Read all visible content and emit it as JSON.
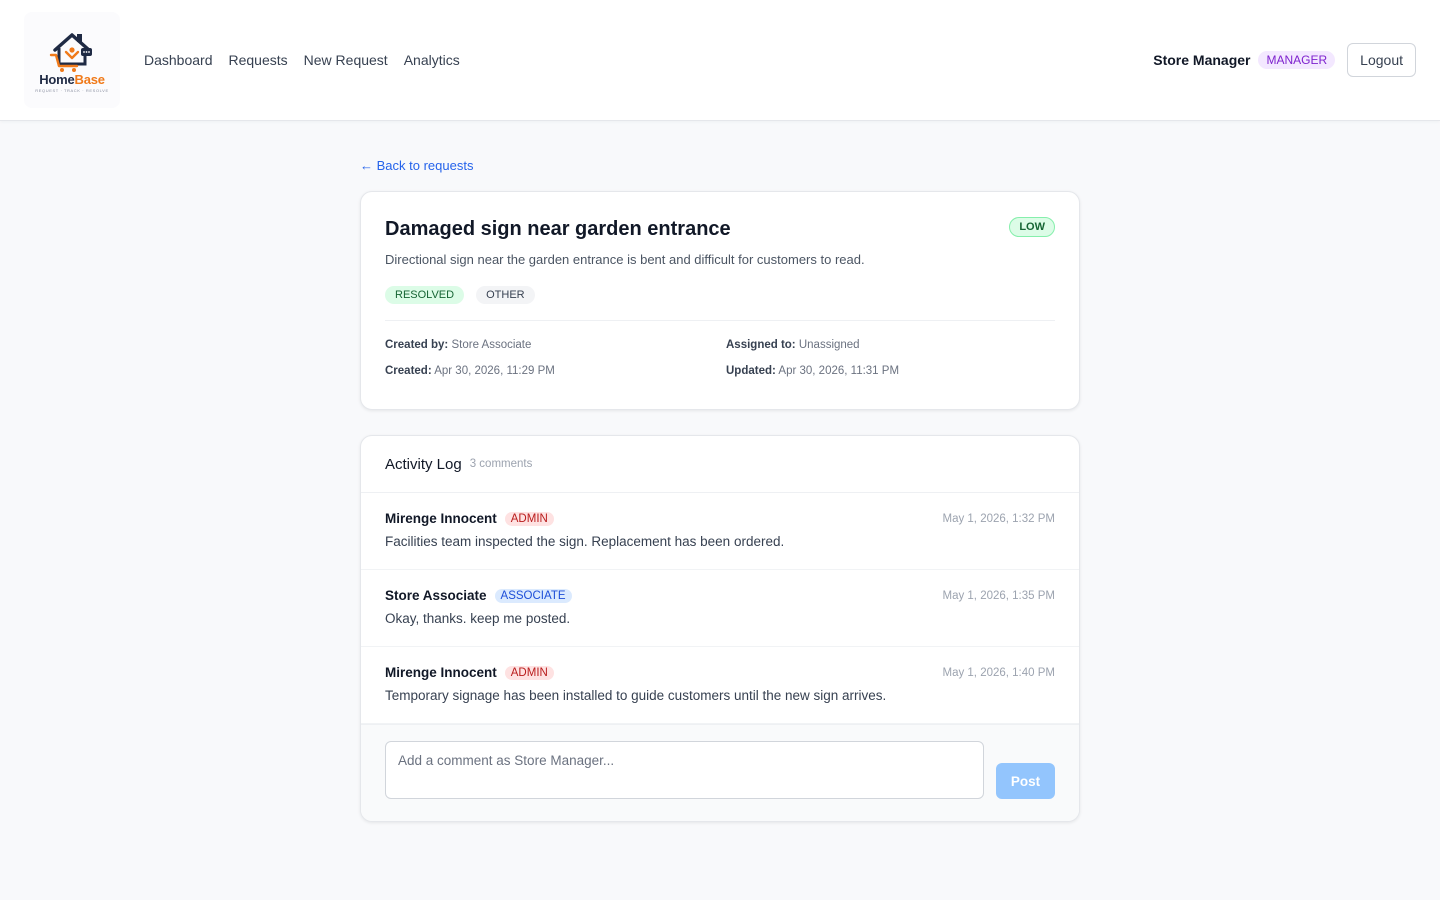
{
  "brand": {
    "name_part1": "Home",
    "name_part2": "Base",
    "tagline": "REQUEST · TRACK · RESOLVE"
  },
  "nav": {
    "items": [
      {
        "label": "Dashboard"
      },
      {
        "label": "Requests"
      },
      {
        "label": "New Request"
      },
      {
        "label": "Analytics"
      }
    ]
  },
  "user": {
    "name": "Store Manager",
    "role": "MANAGER",
    "logout_label": "Logout"
  },
  "back_link": "← Back to requests",
  "request": {
    "title": "Damaged sign near garden entrance",
    "priority": "LOW",
    "description": "Directional sign near the garden entrance is bent and difficult for customers to read.",
    "status": "RESOLVED",
    "category": "OTHER",
    "created_by_label": "Created by:",
    "created_by": "Store Associate",
    "assigned_to_label": "Assigned to:",
    "assigned_to": "Unassigned",
    "created_label": "Created:",
    "created": "Apr 30, 2026, 11:29 PM",
    "updated_label": "Updated:",
    "updated": "Apr 30, 2026, 11:31 PM"
  },
  "activity": {
    "title": "Activity Log",
    "count": "3 comments",
    "comments": [
      {
        "author": "Mirenge Innocent",
        "role": "ADMIN",
        "time": "May 1, 2026, 1:32 PM",
        "body": "Facilities team inspected the sign. Replacement has been ordered."
      },
      {
        "author": "Store Associate",
        "role": "ASSOCIATE",
        "time": "May 1, 2026, 1:35 PM",
        "body": "Okay, thanks. keep me posted."
      },
      {
        "author": "Mirenge Innocent",
        "role": "ADMIN",
        "time": "May 1, 2026, 1:40 PM",
        "body": "Temporary signage has been installed to guide customers until the new sign arrives."
      }
    ],
    "input_placeholder": "Add a comment as Store Manager...",
    "post_label": "Post"
  },
  "colors": {
    "accent": "#2563eb",
    "brand_orange": "#f07a1a",
    "brand_navy": "#1f2a44",
    "status_resolved": "#166534",
    "role_admin": "#b91c1c",
    "role_associate": "#1d4ed8",
    "role_manager": "#7e22ce"
  },
  "icons": {
    "logo": "house-cart-logo-icon"
  }
}
